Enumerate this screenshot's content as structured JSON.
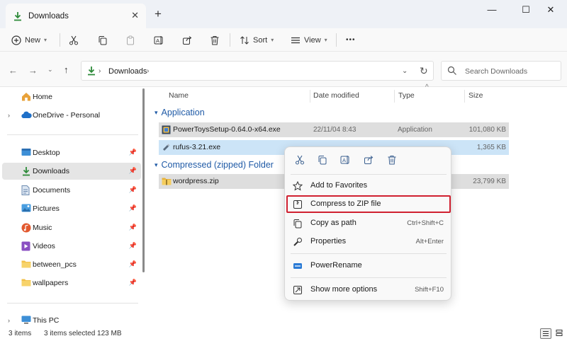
{
  "tab": {
    "title": "Downloads",
    "close": "✕",
    "new": "+"
  },
  "window": {
    "minimize": "—",
    "maximize": "☐",
    "close": "✕"
  },
  "toolbar": {
    "new_label": "New",
    "sort_label": "Sort",
    "view_label": "View",
    "more": "•••"
  },
  "address": {
    "crumb": "Downloads"
  },
  "search": {
    "placeholder": "Search Downloads"
  },
  "sidebar": {
    "items": [
      {
        "label": "Home"
      },
      {
        "label": "OneDrive - Personal"
      },
      {
        "label": "Desktop"
      },
      {
        "label": "Downloads"
      },
      {
        "label": "Documents"
      },
      {
        "label": "Pictures"
      },
      {
        "label": "Music"
      },
      {
        "label": "Videos"
      },
      {
        "label": "between_pcs"
      },
      {
        "label": "wallpapers"
      },
      {
        "label": "This PC"
      }
    ]
  },
  "columns": {
    "name": "Name",
    "date": "Date modified",
    "type": "Type",
    "size": "Size"
  },
  "groups": [
    {
      "label": "Application",
      "files": [
        {
          "name": "PowerToysSetup-0.64.0-x64.exe",
          "date": "22/11/04 8:43",
          "type": "Application",
          "size": "101,080 KB"
        },
        {
          "name": "rufus-3.21.exe",
          "size": "1,365 KB"
        }
      ]
    },
    {
      "label": "Compressed (zipped) Folder",
      "files": [
        {
          "name": "wordpress.zip",
          "size": "23,799 KB"
        }
      ]
    }
  ],
  "context_menu": {
    "items": [
      {
        "label": "Add to Favorites",
        "shortcut": ""
      },
      {
        "label": "Compress to ZIP file",
        "shortcut": ""
      },
      {
        "label": "Copy as path",
        "shortcut": "Ctrl+Shift+C"
      },
      {
        "label": "Properties",
        "shortcut": "Alt+Enter"
      },
      {
        "label": "PowerRename",
        "shortcut": ""
      },
      {
        "label": "Show more options",
        "shortcut": "Shift+F10"
      }
    ]
  },
  "status": {
    "count": "3 items",
    "selected": "3 items selected  123 MB"
  },
  "colors": {
    "accent": "#1f5aa6",
    "highlight_border": "#d02030",
    "selection": "#cce4f7",
    "folder": "#f2c04a",
    "download_green": "#2e8b3a"
  }
}
